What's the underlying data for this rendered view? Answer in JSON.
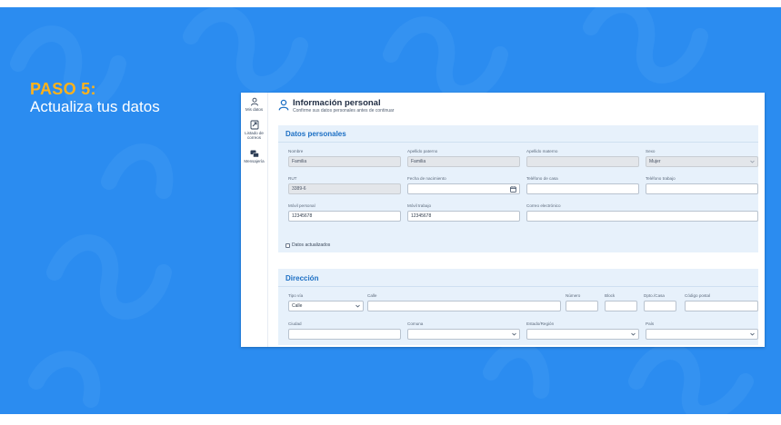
{
  "step": {
    "title": "PASO 5:",
    "subtitle": "Actualiza tus datos"
  },
  "colors": {
    "background": "#2b8cf0",
    "accent": "#ffb21a",
    "section_bg": "#e7f1fb",
    "section_title": "#1c6fc4"
  },
  "sidebar": {
    "items": [
      {
        "label": "Mis datos",
        "icon": "user-icon"
      },
      {
        "label": "Listado de correos",
        "icon": "list-icon"
      },
      {
        "label": "Mensajería",
        "icon": "chat-icon"
      }
    ]
  },
  "header": {
    "title": "Información personal",
    "subtitle": "Confirme sus datos personales antes de continuar",
    "icon": "user-icon"
  },
  "personal": {
    "section_title": "Datos personales",
    "nombre": {
      "label": "Nombre",
      "value": "Familia"
    },
    "apellido_paterno": {
      "label": "Apellido paterno",
      "value": "Familia"
    },
    "apellido_materno": {
      "label": "Apellido materno",
      "value": ""
    },
    "sexo": {
      "label": "Sexo",
      "value": "Mujer"
    },
    "rut": {
      "label": "RUT",
      "value": "3389-6"
    },
    "fecha_nacimiento": {
      "label": "Fecha de nacimiento",
      "value": ""
    },
    "telefono_casa": {
      "label": "Teléfono de casa",
      "value": ""
    },
    "telefono_trabajo": {
      "label": "Teléfono trabajo",
      "value": ""
    },
    "movil_personal": {
      "label": "Móvil personal",
      "value": "12345678"
    },
    "movil_trabajo": {
      "label": "Móvil trabajo",
      "value": "12345678"
    },
    "correo": {
      "label": "Correo electrónico",
      "value": ""
    },
    "checkbox_label": "Datos actualizados"
  },
  "address": {
    "section_title": "Dirección",
    "tipo_via": {
      "label": "Tipo vía",
      "value": "Calle"
    },
    "calle": {
      "label": "Calle",
      "value": ""
    },
    "numero": {
      "label": "Número",
      "value": ""
    },
    "block": {
      "label": "Block",
      "value": ""
    },
    "dpto": {
      "label": "Dpto./Casa",
      "value": ""
    },
    "codigo_postal": {
      "label": "Código postal",
      "value": ""
    },
    "ciudad": {
      "label": "Ciudad",
      "value": ""
    },
    "comuna": {
      "label": "Comuna",
      "value": ""
    },
    "region": {
      "label": "Estado/Región",
      "value": ""
    },
    "pais": {
      "label": "País",
      "value": ""
    }
  }
}
